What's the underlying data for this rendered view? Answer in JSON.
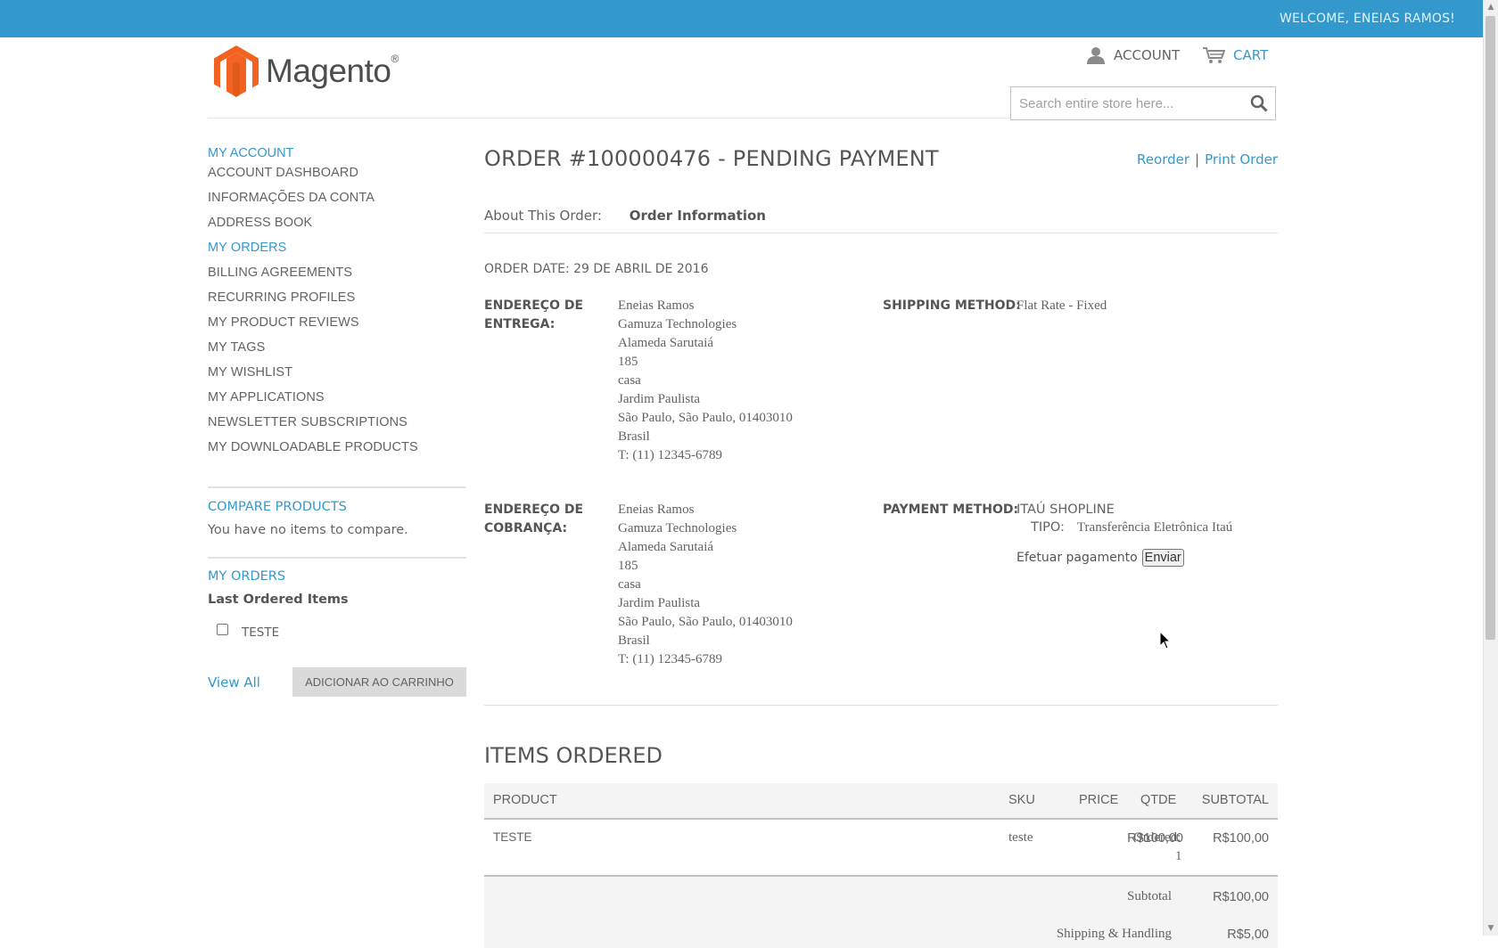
{
  "topbar": {
    "welcome": "WELCOME, ENEIAS RAMOS!"
  },
  "header": {
    "logo_text": "Magento",
    "logo_reg": "®",
    "account_label": "ACCOUNT",
    "cart_label": "CART",
    "search_placeholder": "Search entire store here..."
  },
  "sidebar": {
    "account_title": "MY ACCOUNT",
    "nav": [
      {
        "label": "ACCOUNT DASHBOARD"
      },
      {
        "label": "INFORMAÇÕES DA CONTA"
      },
      {
        "label": "ADDRESS BOOK"
      },
      {
        "label": "MY ORDERS",
        "active": true
      },
      {
        "label": "BILLING AGREEMENTS"
      },
      {
        "label": "RECURRING PROFILES"
      },
      {
        "label": "MY PRODUCT REVIEWS"
      },
      {
        "label": "MY TAGS"
      },
      {
        "label": "MY WISHLIST"
      },
      {
        "label": "MY APPLICATIONS"
      },
      {
        "label": "NEWSLETTER SUBSCRIPTIONS"
      },
      {
        "label": "MY DOWNLOADABLE PRODUCTS"
      }
    ],
    "compare_title": "COMPARE PRODUCTS",
    "compare_empty": "You have no items to compare.",
    "orders_title": "MY ORDERS",
    "last_ordered_title": "Last Ordered Items",
    "last_ordered_item": "TESTE",
    "view_all": "View All",
    "add_to_cart": "ADICIONAR AO CARRINHO"
  },
  "order": {
    "title": "ORDER #100000476 - PENDING PAYMENT",
    "reorder": "Reorder",
    "separator": "|",
    "print": "Print Order",
    "about_label": "About This Order:",
    "about_current": "Order Information",
    "order_date": "ORDER DATE: 29 DE ABRIL DE 2016",
    "shipping_address_label_1": "ENDEREÇO DE",
    "shipping_address_label_2": "ENTREGA:",
    "billing_address_label_1": "ENDEREÇO DE",
    "billing_address_label_2": "COBRANÇA:",
    "address_lines": [
      "Eneias Ramos",
      "Gamuza Technologies",
      "Alameda Sarutaiá",
      "185",
      "casa",
      "Jardim Paulista",
      "São Paulo, São Paulo, 01403010",
      "Brasil",
      "T: (11) 12345-6789"
    ],
    "shipping_method_label": "SHIPPING METHOD:",
    "shipping_method_value": "Flat Rate - Fixed",
    "payment_method_label": "PAYMENT METHOD:",
    "payment_method_value": "ITAÚ SHOPLINE",
    "payment_tipo_label": "TIPO:",
    "payment_tipo_value": "Transferência Eletrônica Itaú",
    "payment_efetuar": "Efetuar pagamento",
    "payment_button": "Enviar"
  },
  "items": {
    "title": "ITEMS ORDERED",
    "headers": {
      "product": "PRODUCT",
      "sku": "SKU",
      "price": "PRICE",
      "qty": "QTDE",
      "subtotal": "SUBTOTAL"
    },
    "row": {
      "product": "TESTE",
      "sku": "teste",
      "price": "R$100,00",
      "qty_label": "Ordered:",
      "qty_value": "1",
      "subtotal": "R$100,00"
    },
    "totals": [
      {
        "label": "Subtotal",
        "value": "R$100,00"
      },
      {
        "label": "Shipping & Handling",
        "value": "R$5,00"
      }
    ]
  }
}
